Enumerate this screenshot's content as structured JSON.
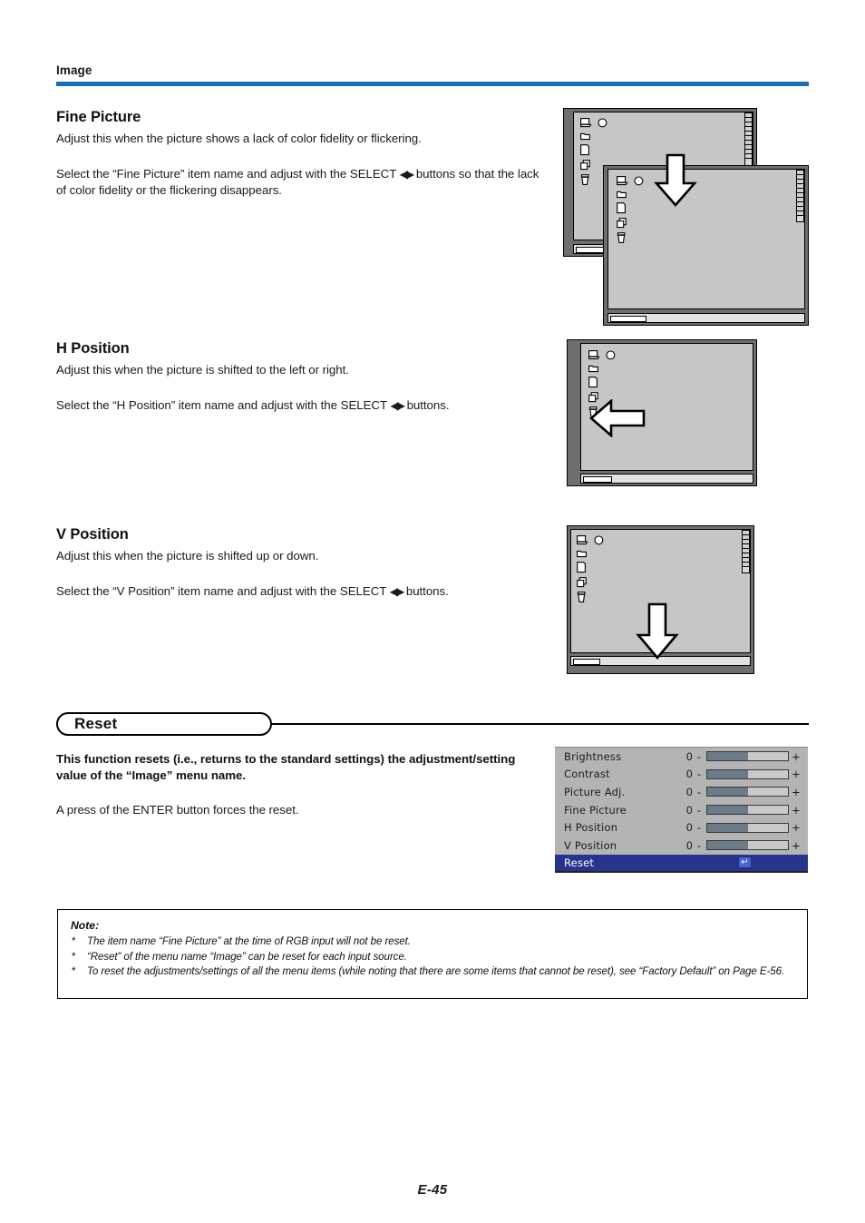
{
  "header": {
    "running_head": "Image",
    "rule_color": "#1b6cb0"
  },
  "sections": [
    {
      "title": "Fine Picture",
      "para1": "Adjust this when the picture shows a lack of color fidelity or flickering.",
      "para2_before": "Select the “Fine Picture” item name and adjust with the SELECT ",
      "para2_arrows": "◀▶",
      "para2_after": " buttons so that the lack of color fidelity or the flickering disappears."
    },
    {
      "title": "H Position",
      "para1": "Adjust this when the picture is shifted to the left or right.",
      "para2_before": "Select the “H Position” item name and adjust with the SELECT ",
      "para2_arrows": "◀▶",
      "para2_after": " buttons."
    },
    {
      "title": "V Position",
      "para1": "Adjust this when the picture is shifted up or down.",
      "para2_before": "Select the “V Position” item name and adjust with the SELECT ",
      "para2_arrows": "◀▶",
      "para2_after": " buttons."
    }
  ],
  "reset_section": {
    "heading": "Reset",
    "para1": "This function resets (i.e., returns to the standard settings) the adjustment/setting value of the “Image” menu name.",
    "para2": "A press of the ENTER button forces the reset."
  },
  "note": {
    "title": "Note:",
    "bullet": "*",
    "items": [
      "The item name “Fine Picture” at the time of RGB input will not be reset.",
      "“Reset” of the menu name “Image” can be reset for each input source.",
      "To reset the adjustments/settings of all the menu items (while noting that there are some items that cannot be reset), see “Factory Default” on Page E-56."
    ]
  },
  "osd_menu": {
    "rows": [
      {
        "label": "Brightness",
        "value": "0",
        "minus": "-",
        "plus": "+",
        "fill_percent": 50
      },
      {
        "label": "Contrast",
        "value": "0",
        "minus": "-",
        "plus": "+",
        "fill_percent": 50
      },
      {
        "label": "Picture Adj.",
        "value": "0",
        "minus": "-",
        "plus": "+",
        "fill_percent": 50
      },
      {
        "label": "Fine Picture",
        "value": "0",
        "minus": "-",
        "plus": "+",
        "fill_percent": 50
      },
      {
        "label": "H Position",
        "value": "0",
        "minus": "-",
        "plus": "+",
        "fill_percent": 50
      },
      {
        "label": "V Position",
        "value": "0",
        "minus": "-",
        "plus": "+",
        "fill_percent": 50
      }
    ],
    "selected_row": {
      "label": "Reset",
      "enter_glyph": "↵"
    },
    "selected_bg_color": "#28348c",
    "bar_fill_color": "#6d7a88",
    "panel_bg_color": "#b4b4b4"
  },
  "figures": {
    "fine_picture": {
      "caption_semantics": "two overlapping desktop windows with a large down arrow",
      "desktop_icons": [
        "computer-icon",
        "circle-icon",
        "folder-icon",
        "document-icon",
        "copy-icon",
        "trash-icon"
      ]
    },
    "h_position": {
      "caption_semantics": "desktop window with a large left arrow",
      "desktop_icons": [
        "computer-icon",
        "circle-icon",
        "folder-icon",
        "document-icon",
        "copy-icon",
        "trash-icon"
      ]
    },
    "v_position": {
      "caption_semantics": "desktop window with a large down arrow",
      "desktop_icons": [
        "computer-icon",
        "circle-icon",
        "folder-icon",
        "document-icon",
        "copy-icon",
        "trash-icon"
      ]
    }
  },
  "footer": {
    "page_number": "E-45"
  }
}
